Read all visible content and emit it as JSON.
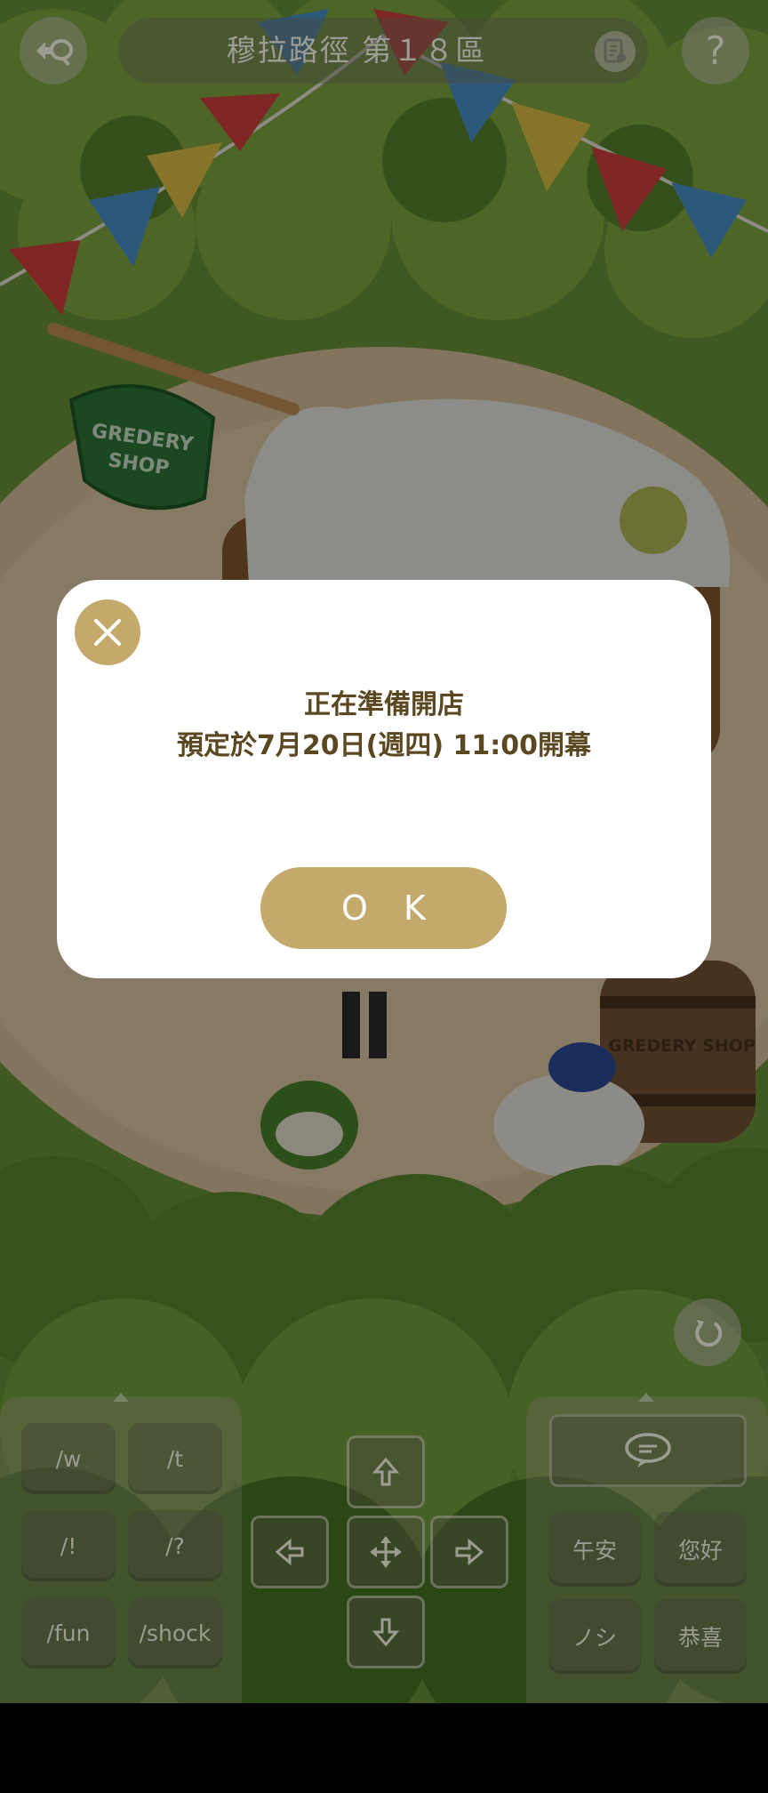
{
  "header": {
    "location_title": "穆拉路徑 第１８區",
    "back_icon": "speech-back-icon",
    "log_icon": "document-list-icon",
    "help_label": "?"
  },
  "scene": {
    "shop_sign_line1": "GREDERY",
    "shop_sign_line2": "SHOP",
    "barrel_text": "GREDERY SHOP"
  },
  "dialog": {
    "message_line1": "正在準備開店",
    "message_line2": "預定於7月20日(週四) 11:00開幕",
    "ok_label": "O K",
    "close_icon": "close-icon"
  },
  "emotes": {
    "left": [
      "/w",
      "/t",
      "/!",
      "/?",
      "/fun",
      "/shock"
    ],
    "right": [
      "午安",
      "您好",
      "ノシ",
      "恭喜"
    ]
  },
  "controls": {
    "rotate_icon": "rotate-camera-icon",
    "chat_icon": "chat-bubble-icon"
  },
  "colors": {
    "accent_gold": "#c4a86c",
    "dialog_text": "#5b4720",
    "dialog_bg": "#ffffff"
  }
}
